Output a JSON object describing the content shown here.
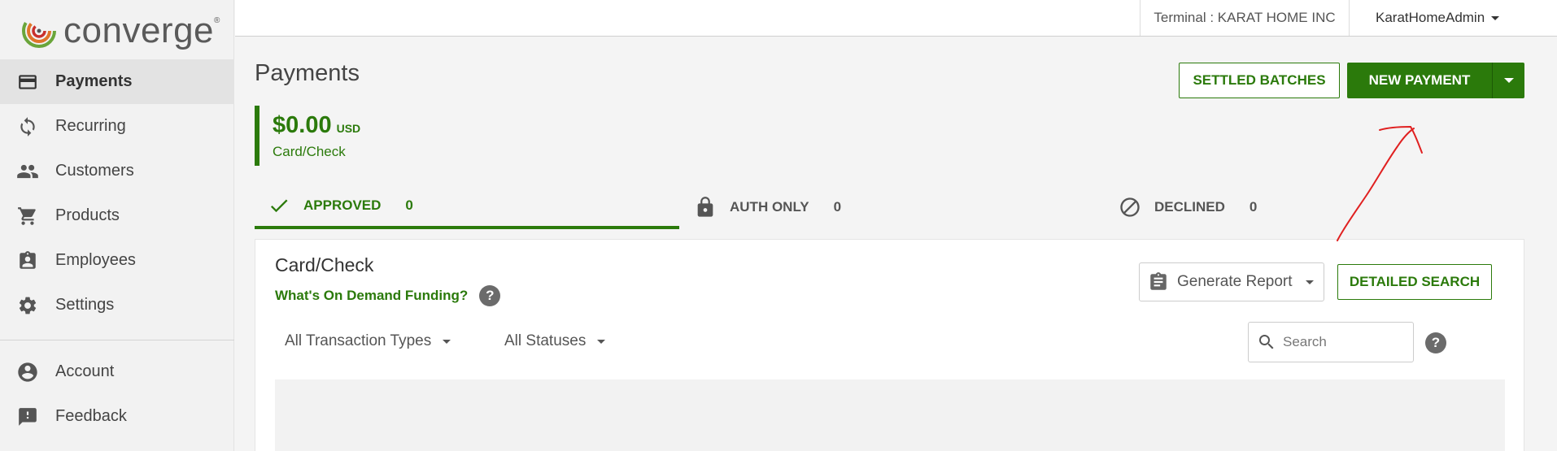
{
  "brand": {
    "name": "converge",
    "reg": "®"
  },
  "sidebar": {
    "items": [
      {
        "label": "Payments",
        "icon": "credit-card-icon",
        "active": true
      },
      {
        "label": "Recurring",
        "icon": "refresh-icon"
      },
      {
        "label": "Customers",
        "icon": "people-icon"
      },
      {
        "label": "Products",
        "icon": "cart-icon"
      },
      {
        "label": "Employees",
        "icon": "badge-icon"
      },
      {
        "label": "Settings",
        "icon": "gear-icon"
      }
    ],
    "secondary": [
      {
        "label": "Account",
        "icon": "account-circle-icon"
      },
      {
        "label": "Feedback",
        "icon": "feedback-icon"
      }
    ]
  },
  "topbar": {
    "terminal": "Terminal : KARAT HOME INC",
    "user": "KaratHomeAdmin"
  },
  "header": {
    "title": "Payments",
    "settled_label": "SETTLED BATCHES",
    "new_payment_label": "NEW PAYMENT"
  },
  "amount": {
    "value": "$0.00",
    "currency": "USD",
    "subtitle": "Card/Check"
  },
  "tabs": [
    {
      "label": "APPROVED",
      "count": "0",
      "icon": "check-icon",
      "active": true
    },
    {
      "label": "AUTH ONLY",
      "count": "0",
      "icon": "lock-icon"
    },
    {
      "label": "DECLINED",
      "count": "0",
      "icon": "block-icon"
    }
  ],
  "panel": {
    "title": "Card/Check",
    "odf_link": "What's On Demand Funding?",
    "help_glyph": "?",
    "generate_report": "Generate Report",
    "detailed_search": "DETAILED SEARCH",
    "filter_types": "All Transaction Types",
    "filter_statuses": "All Statuses",
    "search_placeholder": "Search"
  },
  "colors": {
    "brand_green": "#2b7a0b",
    "annotation_red": "#e02020"
  }
}
